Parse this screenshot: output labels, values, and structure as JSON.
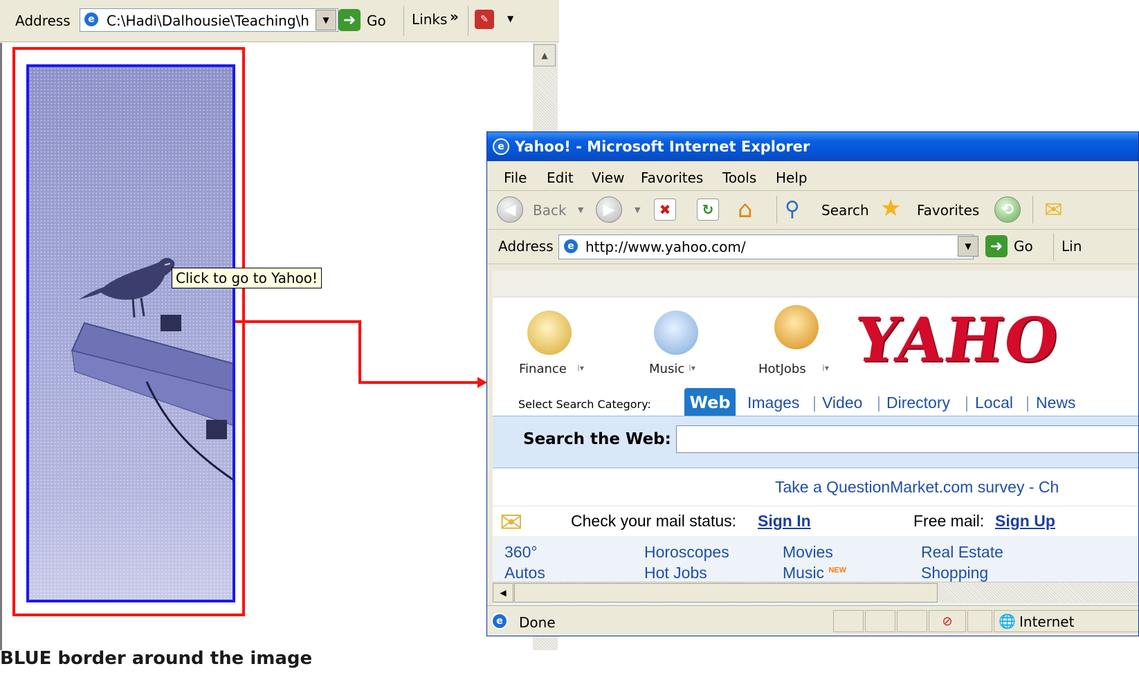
{
  "left_browser": {
    "address_label": "Address",
    "address_value": "C:\\Hadi\\Dalhousie\\Teaching\\hint",
    "go_label": "Go",
    "links_label": "Links",
    "links_chevron": "»",
    "tooltip": "Click to go to Yahoo!",
    "caption": "BLUE border around the image"
  },
  "right_browser": {
    "title": "Yahoo! - Microsoft Internet Explorer",
    "menu": [
      "File",
      "Edit",
      "View",
      "Favorites",
      "Tools",
      "Help"
    ],
    "toolbar": {
      "back_label": "Back",
      "search_label": "Search",
      "favorites_label": "Favorites"
    },
    "address_label": "Address",
    "address_value": "http://www.yahoo.com/",
    "go_label": "Go",
    "links_label": "Lin",
    "page": {
      "logo_text": "YAHO",
      "icons": [
        {
          "label": "Finance",
          "icon": "finance-icon"
        },
        {
          "label": "Music",
          "icon": "music-icon"
        },
        {
          "label": "HotJobs",
          "icon": "hotjobs-icon"
        }
      ],
      "category_label": "Select Search Category:",
      "tabs": [
        "Web",
        "Images",
        "Video",
        "Directory",
        "Local",
        "News"
      ],
      "search_label": "Search the Web:",
      "survey_text": "Take a QuestionMarket.com survey - Ch",
      "mail_status_label": "Check your mail status:",
      "mail_sign_in": "Sign In",
      "free_mail_label": "Free mail:",
      "free_mail_sign_up": "Sign Up",
      "directory_row1": [
        "360°",
        "Horoscopes",
        "Movies",
        "Real Estate"
      ],
      "directory_row2": [
        "Autos",
        "Hot Jobs",
        "Music",
        "Shopping"
      ],
      "new_badge": "NEW"
    },
    "status": {
      "done_label": "Done",
      "zone_label": "Internet"
    }
  }
}
